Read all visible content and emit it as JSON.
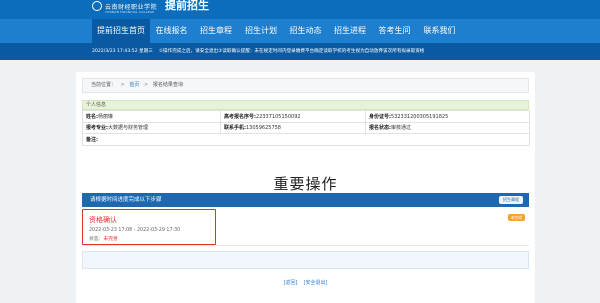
{
  "header": {
    "logo_text": "云南财经职业学院",
    "logo_sub": "YUNNAN FINANCIAL COLLEGE",
    "title": "提前招生"
  },
  "nav": {
    "items": [
      {
        "label": "提前招生首页",
        "active": true
      },
      {
        "label": "在线报名",
        "active": false
      },
      {
        "label": "招生章程",
        "active": false
      },
      {
        "label": "招生计划",
        "active": false
      },
      {
        "label": "招生动态",
        "active": false
      },
      {
        "label": "招生进程",
        "active": false
      },
      {
        "label": "答考生问",
        "active": false
      },
      {
        "label": "联系我们",
        "active": false
      }
    ]
  },
  "notice": {
    "date": "2022/3/23 17:43:52 星期三",
    "text": "①操作完成之后，请安全退出②读取确认提醒：未在规定时间内登录缴费平台确定读取学校的考生视为自动放弃该次所有拟录取资格"
  },
  "breadcrumb": {
    "label": "当前位置：",
    "home": "首页",
    "current": "报名结果查询",
    "sep": ">"
  },
  "info": {
    "section_title": "个人信息",
    "rows": [
      [
        {
          "k": "姓名:",
          "v": "杨丽琳"
        },
        {
          "k": "高考报名序号:",
          "v": "22337105150092"
        },
        {
          "k": "身份证号:",
          "v": "532331200305191825"
        }
      ],
      [
        {
          "k": "报考专业:",
          "v": "大数据与财务管理"
        },
        {
          "k": "联系手机:",
          "v": "13059625758"
        },
        {
          "k": "报名状态:",
          "v": "审核通过"
        }
      ],
      [
        {
          "k": "备注:",
          "v": ""
        },
        {
          "k": "",
          "v": ""
        },
        {
          "k": "",
          "v": ""
        }
      ]
    ]
  },
  "ops": {
    "title": "重要操作",
    "bar_text": "请根据时间进度完成以下步骤",
    "bar_button": "招生章程"
  },
  "step": {
    "name": "资格确认",
    "time": "2022-03-23 17:08 - 2022-03-29 17:30",
    "status_label": "状态：",
    "status_value": "未完善",
    "tag": "未完成"
  },
  "footer": {
    "back": "[返回]",
    "logout": "[安全退出]"
  }
}
